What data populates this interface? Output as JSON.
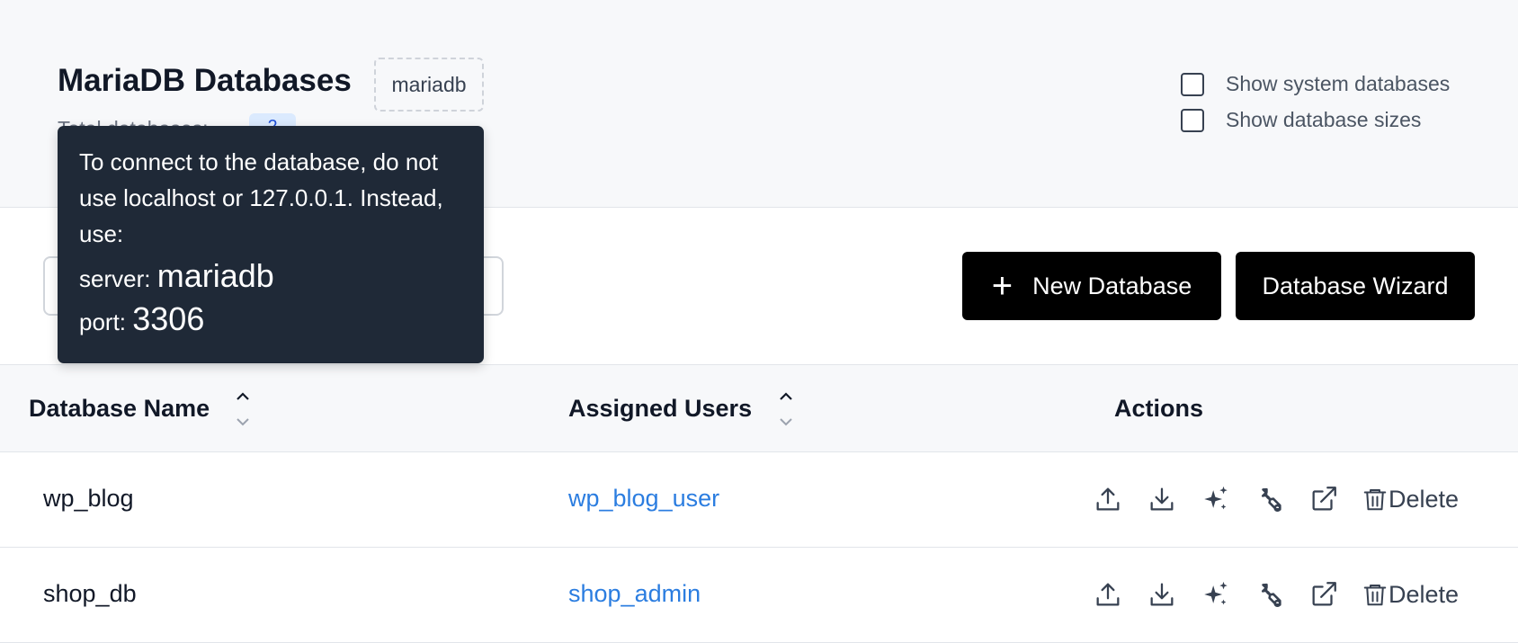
{
  "header": {
    "title": "MariaDB Databases",
    "engine_badge": "mariadb",
    "total_label": "Total databases:",
    "total_count": "2",
    "options": [
      {
        "label": "Show system databases",
        "checked": false
      },
      {
        "label": "Show database sizes",
        "checked": false
      }
    ]
  },
  "toolbar": {
    "search_placeholder": "",
    "new_database_label": "New Database",
    "wizard_label": "Database Wizard"
  },
  "tooltip": {
    "text": "To connect to the database, do not use localhost or 127.0.0.1. Instead, use:",
    "server_label": "server:",
    "server_value": "mariadb",
    "port_label": "port:",
    "port_value": "3306"
  },
  "table": {
    "columns": [
      "Database Name",
      "Assigned Users",
      "Actions"
    ],
    "rows": [
      {
        "name": "wp_blog",
        "user": "wp_blog_user"
      },
      {
        "name": "shop_db",
        "user": "shop_admin"
      }
    ],
    "delete_label": "Delete",
    "action_icons": [
      "upload-icon",
      "download-icon",
      "sparkles-icon",
      "wrench-icon",
      "external-link-icon",
      "trash-icon"
    ]
  },
  "colors": {
    "link": "#2b7de0",
    "button_bg": "#000000",
    "tooltip_bg": "#1f2937",
    "count_badge_bg": "#dbeafe"
  }
}
